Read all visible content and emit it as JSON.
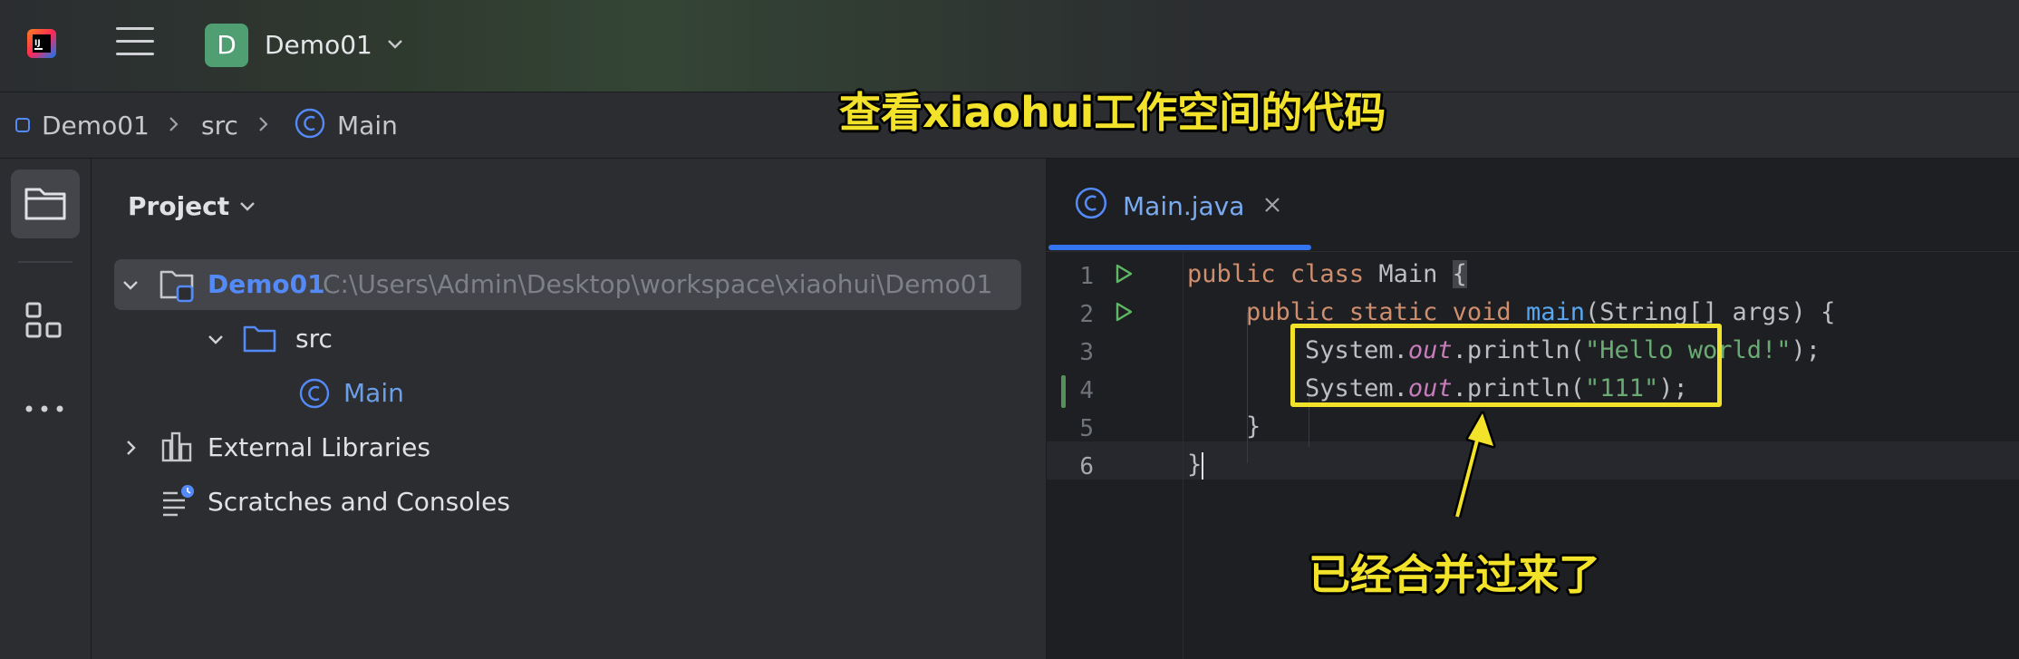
{
  "titlebar": {
    "project_initial": "D",
    "project_name": "Demo01"
  },
  "breadcrumb": {
    "items": [
      "Demo01",
      "src",
      "Main"
    ]
  },
  "project_panel": {
    "title": "Project",
    "tree": [
      {
        "label": "Demo01",
        "path": "C:\\Users\\Admin\\Desktop\\workspace\\xiaohui\\Demo01"
      },
      {
        "label": "src"
      },
      {
        "label": "Main"
      },
      {
        "label": "External Libraries"
      },
      {
        "label": "Scratches and Consoles"
      }
    ]
  },
  "editor": {
    "tab_label": "Main.java",
    "line_numbers": [
      "1",
      "2",
      "3",
      "4",
      "5",
      "6"
    ],
    "code": {
      "line1": {
        "kw1": "public",
        "kw2": "class",
        "name": "Main",
        "brace": "{"
      },
      "line2": {
        "kw1": "public",
        "kw2": "static",
        "kw3": "void",
        "fn": "main",
        "rest": "(String[] args) {"
      },
      "line3": {
        "pre": "System.",
        "field": "out",
        "mid": ".println(",
        "str": "\"Hello world!\"",
        "end": ");"
      },
      "line4": {
        "pre": "System.",
        "field": "out",
        "mid": ".println(",
        "str": "\"111\"",
        "end": ");"
      },
      "line5": {
        "text": "}"
      },
      "line6": {
        "text": "}"
      }
    }
  },
  "annotations": {
    "title": "查看xiaohui工作空间的代码",
    "callout": "已经合并过来了"
  },
  "colors": {
    "accent": "#3574f0",
    "annotation": "#f2e32a",
    "keyword": "#cf8e6d",
    "string": "#6aab73"
  }
}
